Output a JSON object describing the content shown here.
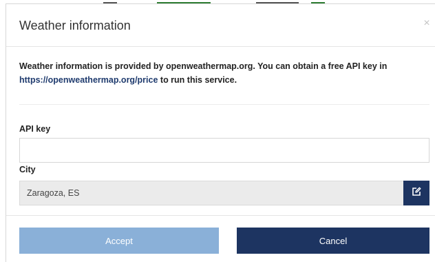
{
  "modal": {
    "title": "Weather information",
    "close_symbol": "×",
    "close_icon": "close-icon",
    "intro_text": "Weather information is provided by openweathermap.org. You can obtain a free API key in",
    "intro_link": "https://openweathermap.org/price",
    "intro_suffix": "to run this service."
  },
  "form": {
    "api_key_label": "API key",
    "api_key_value": "",
    "city_label": "City",
    "city_value": "Zaragoza, ES",
    "city_edit_icon": "edit-icon"
  },
  "buttons": {
    "accept_label": "Accept",
    "cancel_label": "Cancel"
  },
  "colors": {
    "primary": "#1d3461",
    "accept_disabled": "#8ab0d8",
    "link": "#1f3b6e",
    "readonly_bg": "#ebebeb"
  }
}
